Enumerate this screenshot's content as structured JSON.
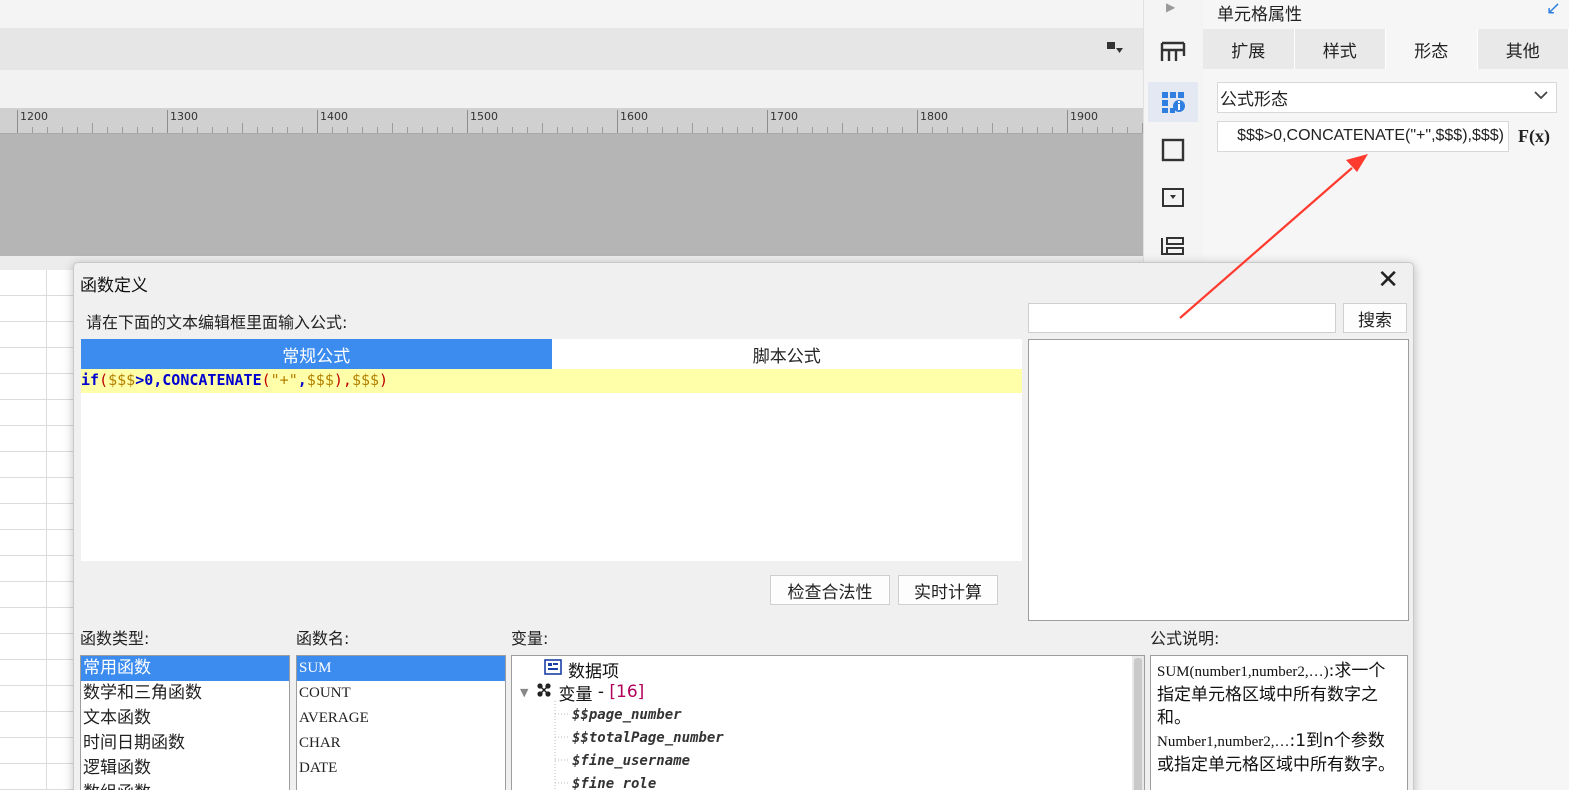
{
  "ruler": {
    "labels": [
      "1200",
      "1300",
      "1400",
      "1500",
      "1600",
      "1700",
      "1800",
      "1900"
    ]
  },
  "props": {
    "title": "单元格属性",
    "tabs": [
      "扩展",
      "样式",
      "形态",
      "其他"
    ],
    "active_tab": "形态",
    "display_mode": "公式形态",
    "formula_text": "$$$>0,CONCATENATE(\"+\",$$$),$$$)",
    "fx_label": "F(x)"
  },
  "dialog": {
    "title": "函数定义",
    "prompt": "请在下面的文本编辑框里面输入公式:",
    "tabs": [
      "常规公式",
      "脚本公式"
    ],
    "formula": {
      "if": "if",
      "open": "(",
      "v1": "$$$",
      "gt0": ">0,",
      "concat": "CONCATENATE",
      "open2": "(",
      "plus": "\"+\"",
      "comma": ",",
      "v2": "$$$",
      "close2": "),",
      "v3": "$$$",
      "close": ")"
    },
    "check_button": "检查合法性",
    "calc_button": "实时计算",
    "search_button": "搜索",
    "function_type_label": "函数类型:",
    "function_name_label": "函数名:",
    "variable_label": "变量:",
    "description_label": "公式说明:",
    "function_types": [
      "常用函数",
      "数学和三角函数",
      "文本函数",
      "时间日期函数",
      "逻辑函数",
      "数组函数"
    ],
    "function_names": [
      "SUM",
      "COUNT",
      "AVERAGE",
      "CHAR",
      "DATE"
    ],
    "variables": {
      "data_item": "数据项",
      "var_group": "变量",
      "var_dash": " - ",
      "var_count": "[16]",
      "items": [
        "$$page_number",
        "$$totalPage_number",
        "$fine_username",
        "$fine_role"
      ]
    },
    "description": {
      "sig": "SUM(number1,number2,…)",
      "sig_text": ":求一个指定单元格区域中所有数字之和。",
      "param": "Number1,number2,…",
      "param_text": ":1到n个参数或指定单元格区域中所有数字。"
    }
  },
  "colors": {
    "accent": "#3c8cf0",
    "editor_highlight": "#ffffaa",
    "arrow": "#ff3b30"
  }
}
